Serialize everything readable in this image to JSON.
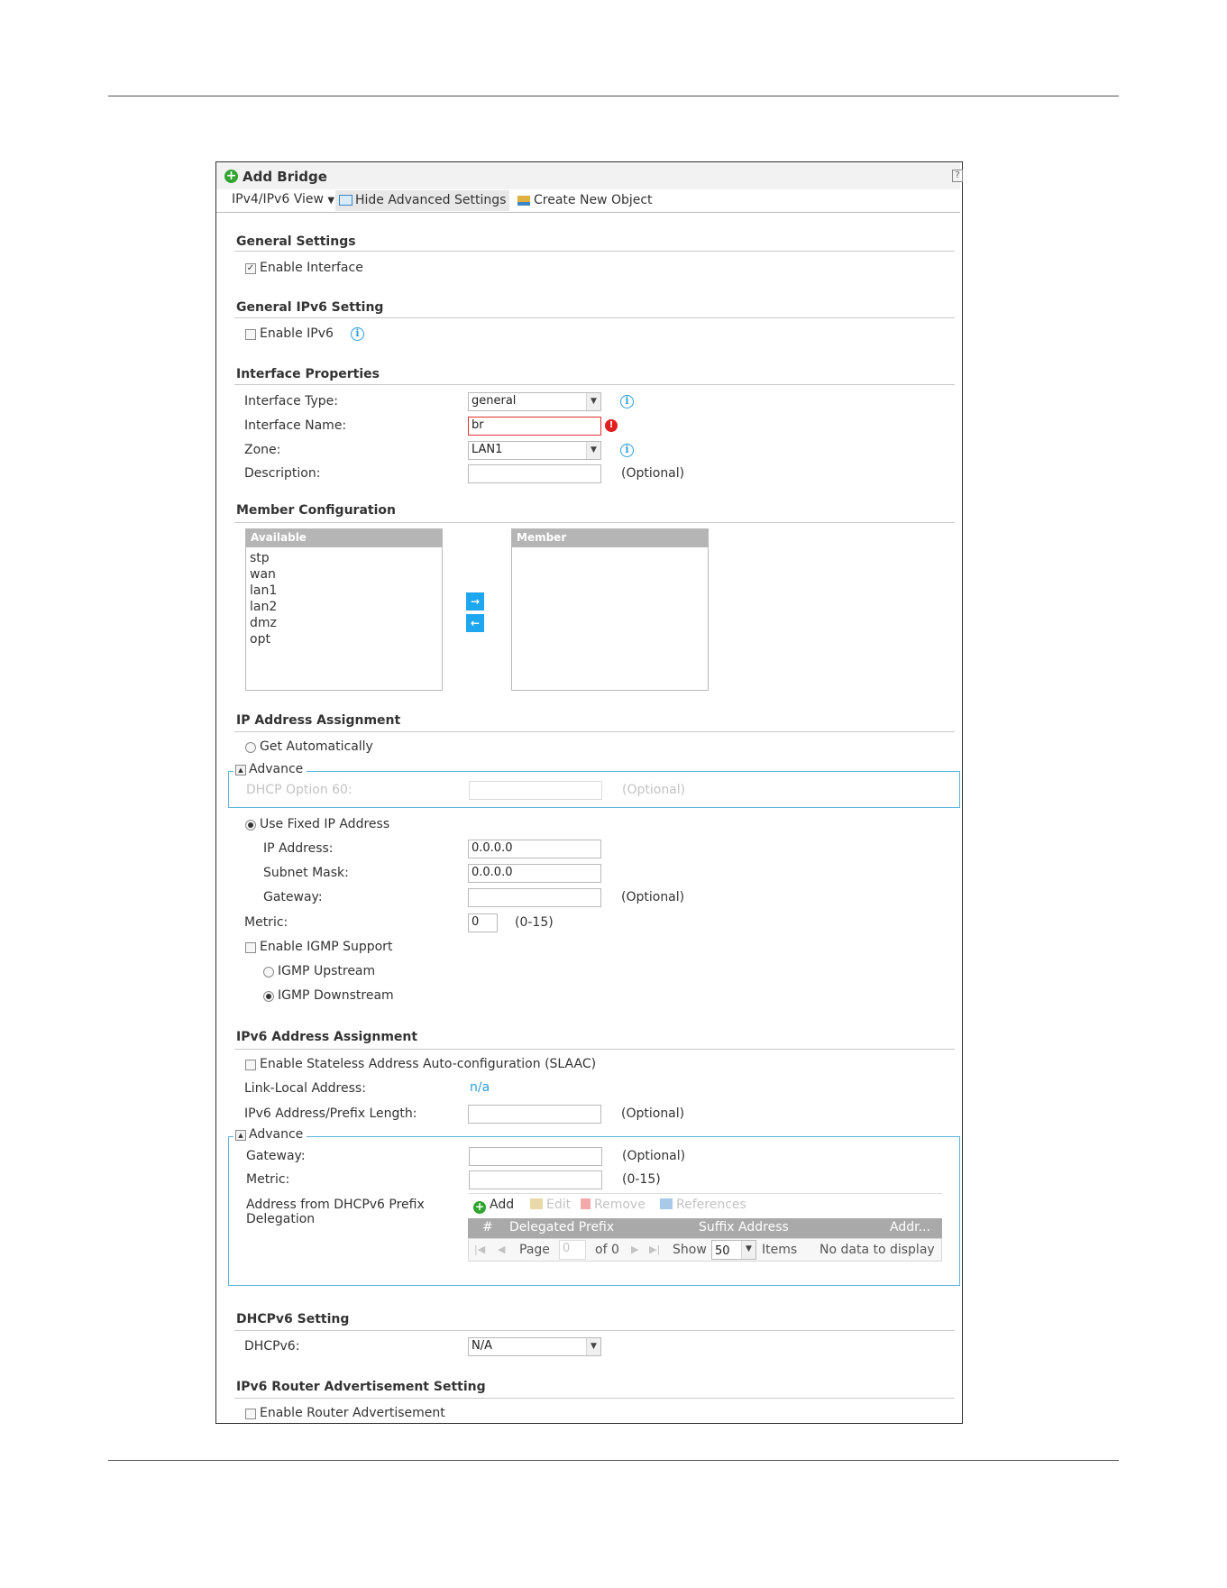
{
  "dialog": {
    "title": "Add Bridge",
    "help_icon": "help-icon",
    "toolbar": {
      "view_menu": "IPv4/IPv6 View",
      "hide_advanced": "Hide Advanced Settings",
      "create_object": "Create New Object"
    }
  },
  "general": {
    "heading": "General Settings",
    "enable_interface": "Enable Interface",
    "enable_interface_checked": true
  },
  "general_ipv6": {
    "heading": "General IPv6 Setting",
    "enable_ipv6": "Enable IPv6"
  },
  "iface": {
    "heading": "Interface Properties",
    "type_label": "Interface Type:",
    "type_value": "general",
    "name_label": "Interface Name:",
    "name_value": "br",
    "zone_label": "Zone:",
    "zone_value": "LAN1",
    "desc_label": "Description:",
    "desc_hint": "(Optional)"
  },
  "member": {
    "heading": "Member Configuration",
    "available_header": "Available",
    "member_header": "Member",
    "available": [
      "stp",
      "wan",
      "lan1",
      "lan2",
      "dmz",
      "opt"
    ],
    "move_right": "→",
    "move_left": "←"
  },
  "ipv4": {
    "heading": "IP Address Assignment",
    "get_auto": "Get Automatically",
    "advance": "Advance",
    "dhcp_opt60": "DHCP Option 60:",
    "dhcp_opt60_hint": "(Optional)",
    "use_fixed": "Use Fixed IP Address",
    "ip_label": "IP Address:",
    "ip_value": "0.0.0.0",
    "mask_label": "Subnet Mask:",
    "mask_value": "0.0.0.0",
    "gw_label": "Gateway:",
    "gw_hint": "(Optional)",
    "metric_label": "Metric:",
    "metric_value": "0",
    "metric_hint": "(0-15)",
    "igmp": "Enable IGMP Support",
    "igmp_up": "IGMP Upstream",
    "igmp_down": "IGMP Downstream"
  },
  "ipv6": {
    "heading": "IPv6 Address Assignment",
    "slaac": "Enable Stateless Address Auto-configuration (SLAAC)",
    "link_local_label": "Link-Local Address:",
    "link_local_value": "n/a",
    "prefix_label": "IPv6 Address/Prefix Length:",
    "prefix_hint": "(Optional)",
    "advance": "Advance",
    "gw_label": "Gateway:",
    "gw_hint": "(Optional)",
    "metric_label": "Metric:",
    "metric_hint": "(0-15)",
    "deleg_label": "Address from DHCPv6 Prefix Delegation",
    "grid_toolbar": {
      "add": "Add",
      "edit": "Edit",
      "remove": "Remove",
      "references": "References"
    },
    "grid_columns": [
      "#",
      "Delegated Prefix",
      "Suffix Address",
      "Addr..."
    ],
    "pager": {
      "page": "Page",
      "page_value": "0",
      "of": "of 0",
      "show": "Show",
      "show_value": "50",
      "items": "Items",
      "empty": "No data to display"
    }
  },
  "dhcpv6": {
    "heading": "DHCPv6 Setting",
    "label": "DHCPv6:",
    "value": "N/A"
  },
  "ra": {
    "heading": "IPv6 Router Advertisement Setting",
    "enable": "Enable Router Advertisement"
  },
  "colors": {
    "accent": "#1ea6ee",
    "info": "#2a9ee0",
    "error": "#e02020",
    "add_green": "#2fa52f",
    "grid_header": "#a9a9a9"
  }
}
